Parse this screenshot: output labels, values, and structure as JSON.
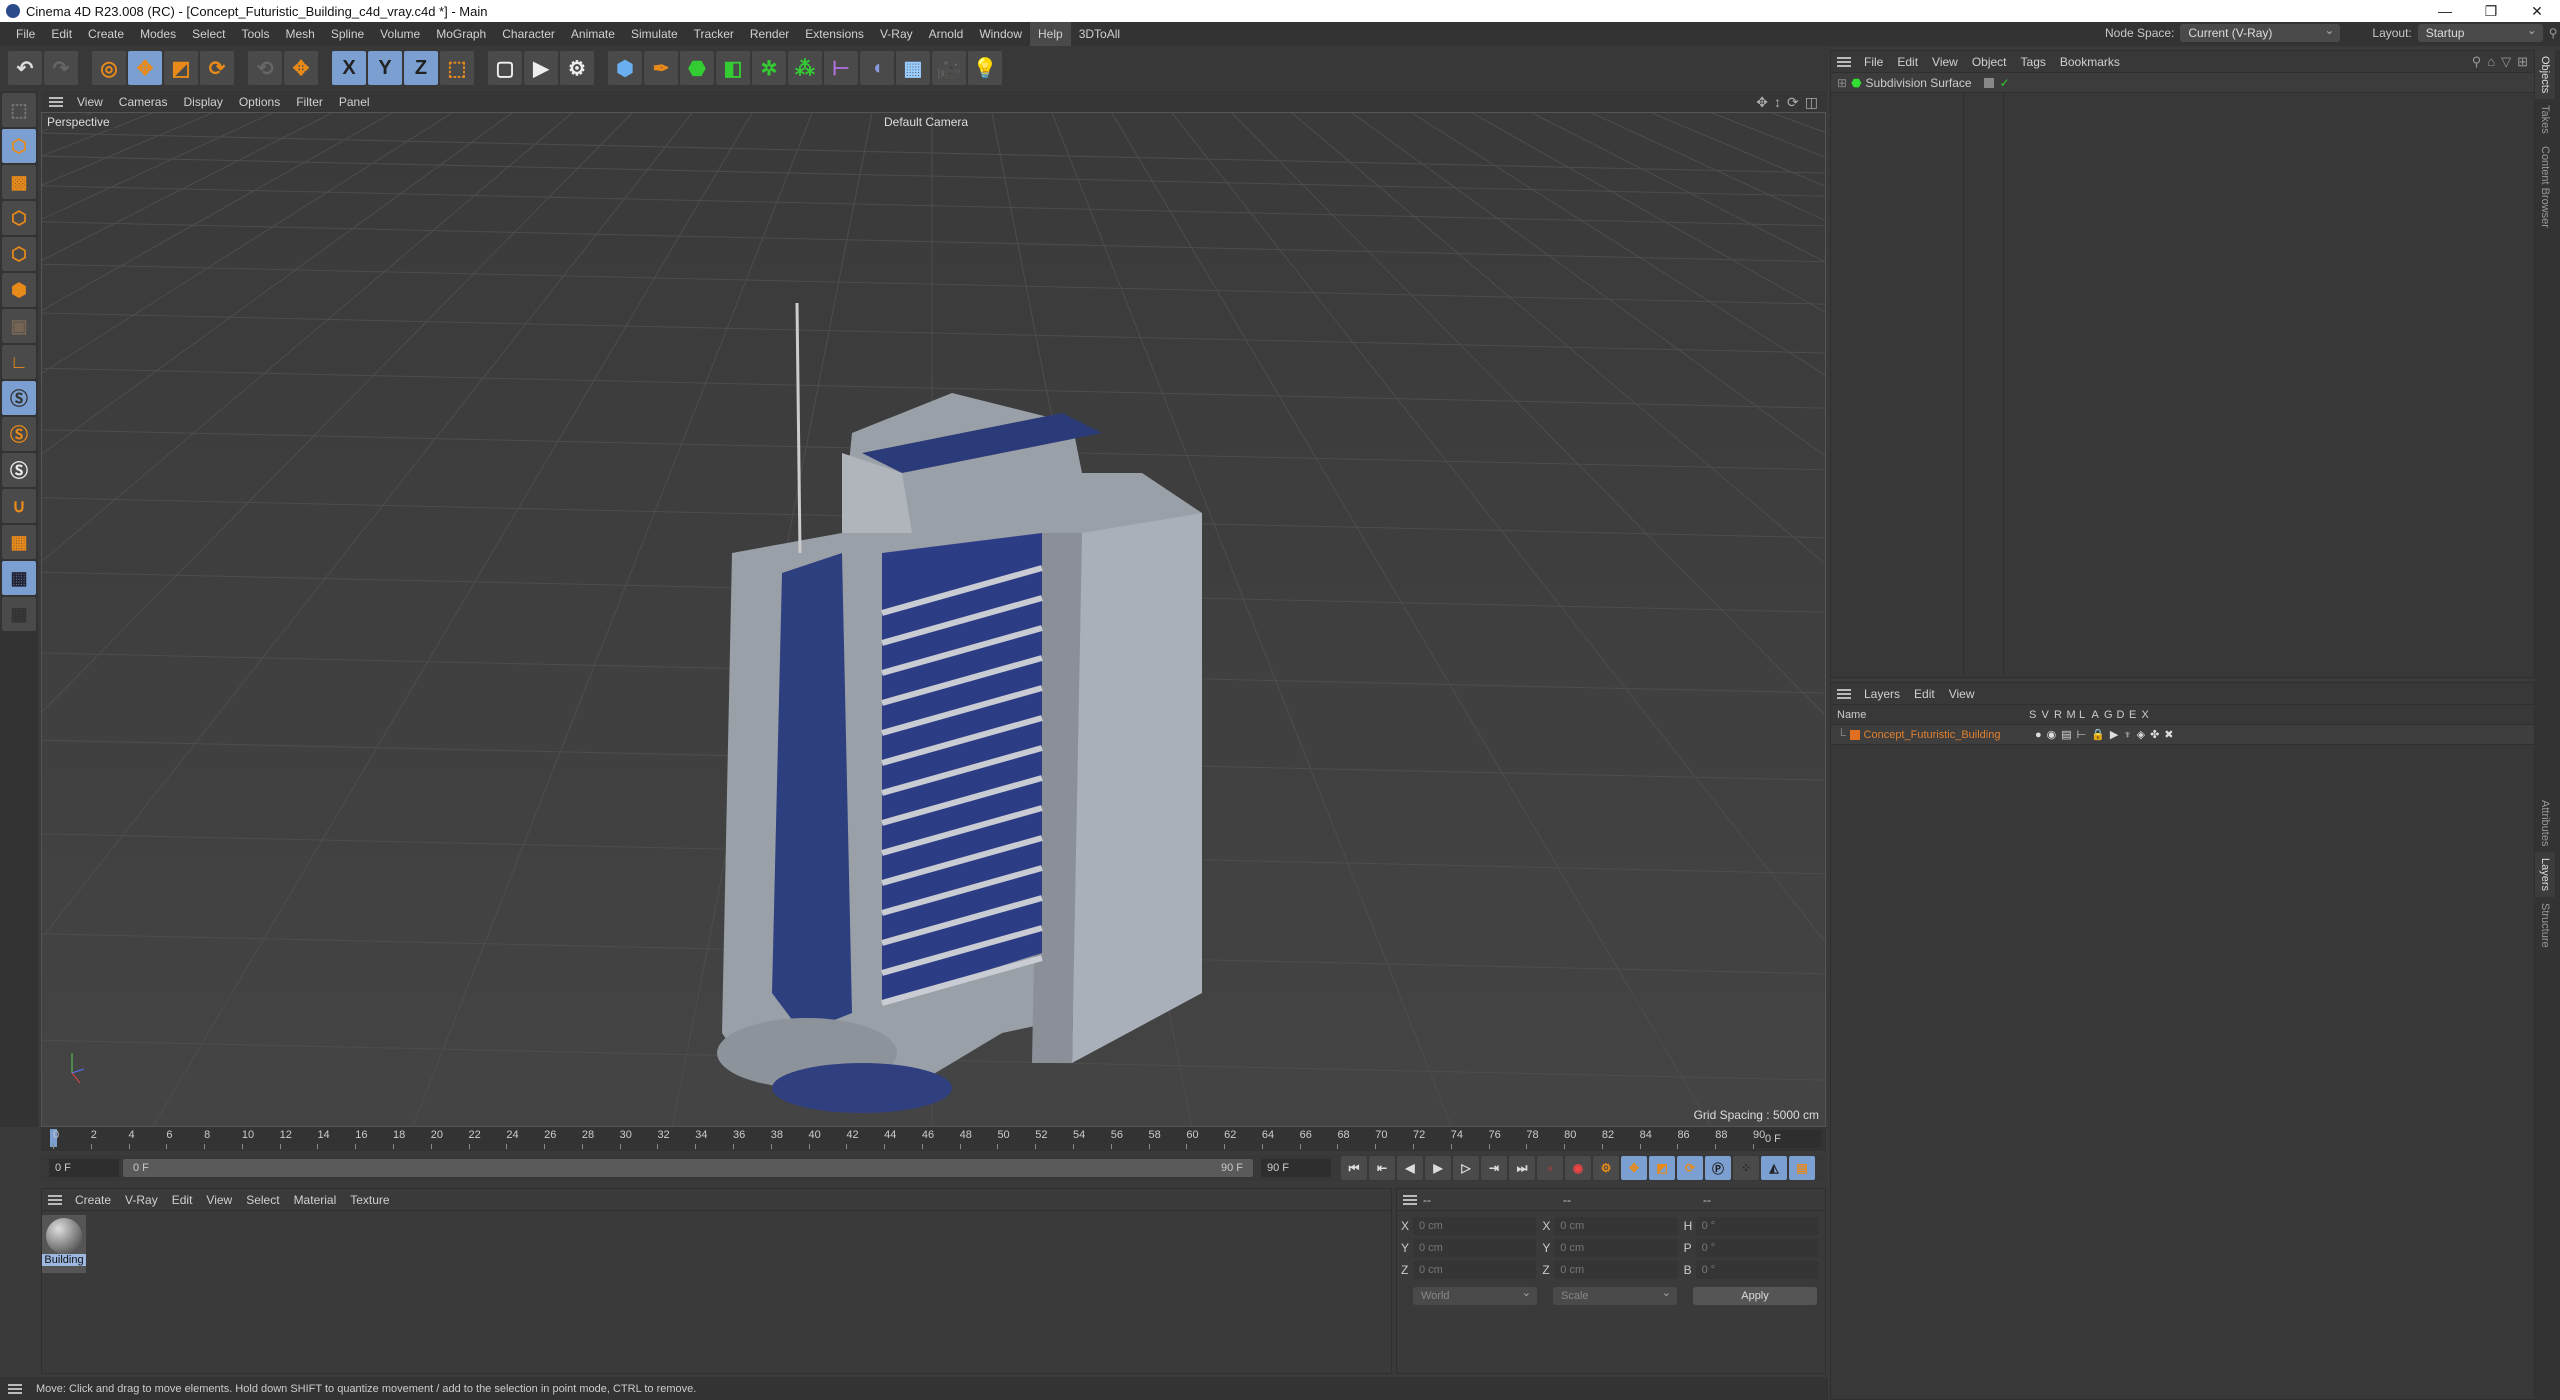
{
  "window": {
    "title": "Cinema 4D R23.008 (RC) - [Concept_Futuristic_Building_c4d_vray.c4d *] - Main",
    "controls": [
      "—",
      "❐",
      "✕"
    ]
  },
  "menubar": [
    "File",
    "Edit",
    "Create",
    "Modes",
    "Select",
    "Tools",
    "Mesh",
    "Spline",
    "Volume",
    "MoGraph",
    "Character",
    "Animate",
    "Simulate",
    "Tracker",
    "Render",
    "Extensions",
    "V-Ray",
    "Arnold",
    "Window",
    "Help",
    "3DToAll"
  ],
  "menubar_active": "Help",
  "node_space": {
    "label": "Node Space:",
    "value": "Current (V-Ray)"
  },
  "layout": {
    "label": "Layout:",
    "value": "Startup"
  },
  "toolbar": {
    "axis_x": "X",
    "axis_y": "Y",
    "axis_z": "Z"
  },
  "viewport": {
    "menu": [
      "View",
      "Cameras",
      "Display",
      "Options",
      "Filter",
      "Panel"
    ],
    "view_name": "Perspective",
    "camera": "Default Camera",
    "grid_spacing": "Grid Spacing : 5000 cm"
  },
  "timeline": {
    "ticks": [
      0,
      2,
      4,
      6,
      8,
      10,
      12,
      14,
      16,
      18,
      20,
      22,
      24,
      26,
      28,
      30,
      32,
      34,
      36,
      38,
      40,
      42,
      44,
      46,
      48,
      50,
      52,
      54,
      56,
      58,
      60,
      62,
      64,
      66,
      68,
      70,
      72,
      74,
      76,
      78,
      80,
      82,
      84,
      86,
      88,
      90
    ],
    "current_frame": "0 F",
    "start": "0 F",
    "range_start": "0 F",
    "range_end": "90 F",
    "end": "90 F"
  },
  "materials": {
    "menu": [
      "Create",
      "V-Ray",
      "Edit",
      "View",
      "Select",
      "Material",
      "Texture"
    ],
    "items": [
      {
        "name": "Building"
      }
    ]
  },
  "coordinates": {
    "headers": [
      "--",
      "--",
      "--"
    ],
    "rows": [
      {
        "l1": "X",
        "v1": "0 cm",
        "l2": "X",
        "v2": "0 cm",
        "l3": "H",
        "v3": "0 °"
      },
      {
        "l1": "Y",
        "v1": "0 cm",
        "l2": "Y",
        "v2": "0 cm",
        "l3": "P",
        "v3": "0 °"
      },
      {
        "l1": "Z",
        "v1": "0 cm",
        "l2": "Z",
        "v2": "0 cm",
        "l3": "B",
        "v3": "0 °"
      }
    ],
    "mode": "World",
    "type": "Scale",
    "apply": "Apply"
  },
  "status": "Move: Click and drag to move elements. Hold down SHIFT to quantize movement / add to the selection in point mode, CTRL to remove.",
  "objects": {
    "menu": [
      "File",
      "Edit",
      "View",
      "Object",
      "Tags",
      "Bookmarks"
    ],
    "items": [
      {
        "name": "Subdivision Surface"
      }
    ]
  },
  "layers": {
    "menu": [
      "Layers",
      "Edit",
      "View"
    ],
    "columns": [
      "Name",
      "S",
      "V",
      "R",
      "M",
      "L",
      "A",
      "G",
      "D",
      "E",
      "X"
    ],
    "items": [
      {
        "name": "Concept_Futuristic_Building",
        "color": "#e07020"
      }
    ]
  },
  "side_tabs": [
    "Objects",
    "Takes",
    "Content Browser",
    "Attributes",
    "Layers",
    "Structure"
  ],
  "colors": {
    "accent": "#7a9fd0",
    "orange": "#e88a1a",
    "layer": "#e07020"
  }
}
